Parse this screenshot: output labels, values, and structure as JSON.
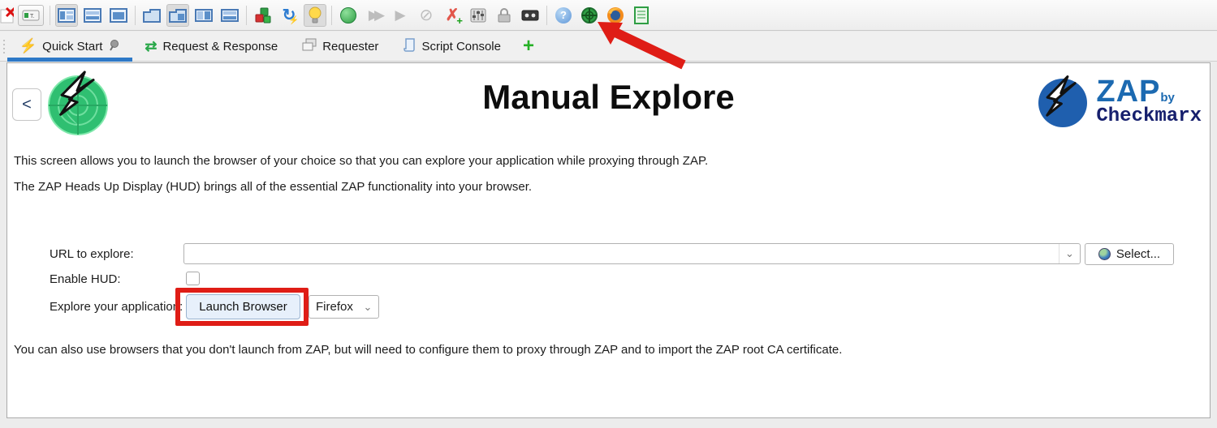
{
  "toolbar": {
    "icons": [
      {
        "name": "new-session-icon"
      },
      {
        "name": "mode-selector",
        "label": "T."
      },
      {
        "name": "layout-maximize-icon",
        "selected": true
      },
      {
        "name": "layout-horizontal-icon"
      },
      {
        "name": "layout-full-screen-icon"
      },
      {
        "name": "window-tab-plain-icon"
      },
      {
        "name": "window-tab-tree-icon",
        "selected": true
      },
      {
        "name": "window-tab-columns-icon"
      },
      {
        "name": "window-tab-rows-icon"
      },
      {
        "name": "manage-addons-icon"
      },
      {
        "name": "check-updates-icon",
        "glyph": "↻"
      },
      {
        "name": "hud-lightbulb-icon",
        "selected": true
      },
      {
        "name": "record-icon"
      },
      {
        "name": "step-icon",
        "glyph": "▶▶",
        "disabled": true
      },
      {
        "name": "continue-icon",
        "glyph": "▶",
        "disabled": true
      },
      {
        "name": "break-off-icon",
        "glyph": "⊘",
        "disabled": true
      },
      {
        "name": "add-break-point-icon",
        "glyph": "✗",
        "plus": "+"
      },
      {
        "name": "options-sliders-icon"
      },
      {
        "name": "lock-icon"
      },
      {
        "name": "cassette-icon"
      },
      {
        "name": "help-icon",
        "glyph": "?"
      },
      {
        "name": "zap-target-icon"
      },
      {
        "name": "firefox-icon"
      },
      {
        "name": "notes-icon"
      }
    ]
  },
  "tabs": {
    "items": [
      {
        "label": "Quick Start",
        "active": true
      },
      {
        "label": "Request & Response",
        "active": false
      },
      {
        "label": "Requester",
        "active": false
      },
      {
        "label": "Script Console",
        "active": false
      }
    ],
    "new_tab_label": "+"
  },
  "content": {
    "back_button": "<",
    "title": "Manual Explore",
    "intro1": "This screen allows you to launch the browser of your choice so that you can explore your application while proxying through ZAP.",
    "intro2": "The ZAP Heads Up Display (HUD) brings all of the essential ZAP functionality into your browser.",
    "footer_note": "You can also use browsers that you don't launch from ZAP, but will need to configure them to proxy through ZAP and to import the ZAP root CA certificate.",
    "form": {
      "url_label": "URL to explore:",
      "url_value": "",
      "select_button": "Select...",
      "hud_label": "Enable HUD:",
      "hud_checked": false,
      "explore_label": "Explore your application:",
      "launch_button": "Launch Browser",
      "browser_value": "Firefox"
    },
    "logo": {
      "zap": "ZAP",
      "by": "by",
      "checkmarx": "Checkmarx"
    }
  },
  "colors": {
    "active_tab_underline": "#2e79c7",
    "annotation_red": "#df1d16",
    "zap_green": "#2fbf71",
    "brand_blue": "#1c6ab1",
    "checkmarx_navy": "#161f6d"
  }
}
